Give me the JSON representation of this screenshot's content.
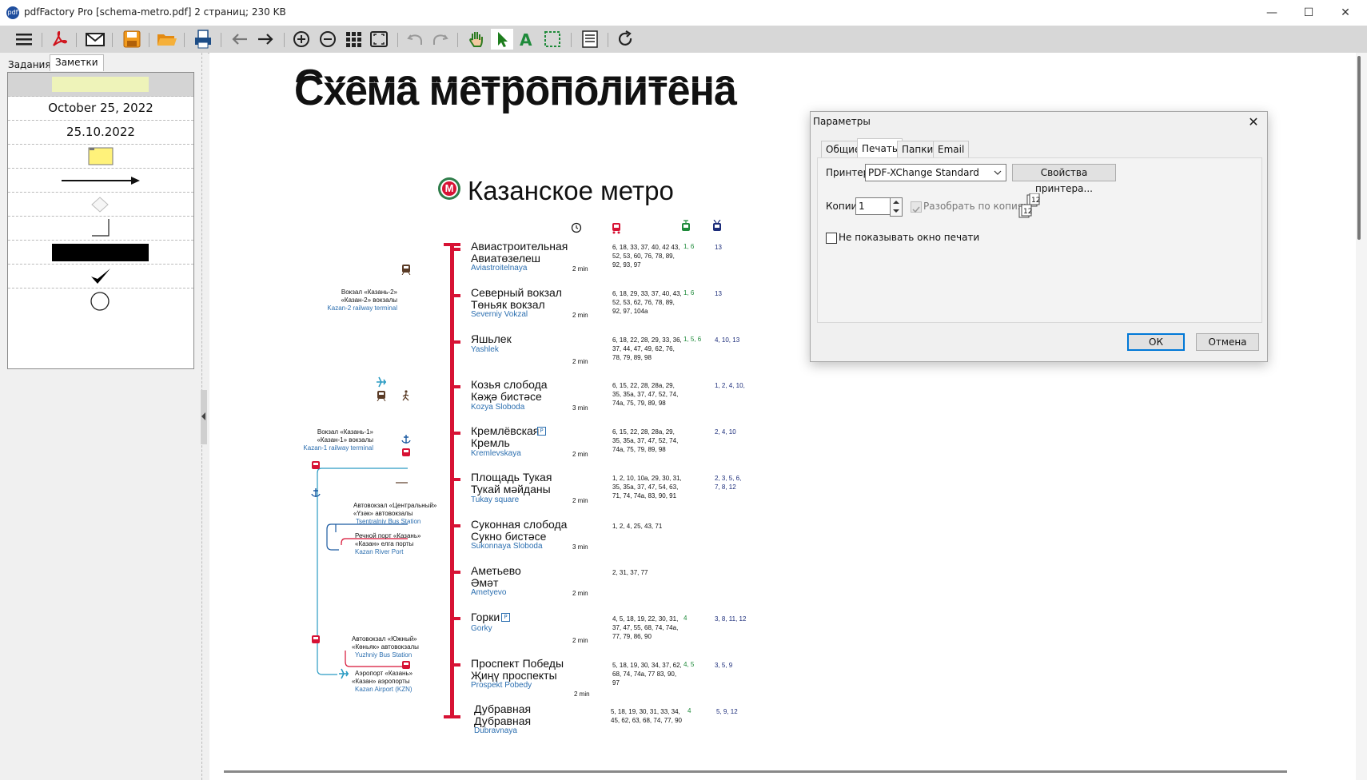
{
  "window": {
    "title": "pdfFactory Pro [schema-metro.pdf] 2 страниц; 230 KB",
    "app_icon_text": "pdf",
    "min_glyph": "—",
    "max_glyph": "☐",
    "close_glyph": "✕"
  },
  "toolbar": {
    "icons": [
      "menu-icon",
      "pdf-icon",
      "email-icon",
      "save-icon",
      "open-folder-icon",
      "print-icon",
      "back-arrow-icon",
      "forward-arrow-icon",
      "zoom-in-icon",
      "zoom-out-icon",
      "thumbnails-icon",
      "fit-page-icon",
      "undo-icon",
      "redo-icon",
      "hand-tool-icon",
      "select-arrow-icon",
      "text-tool-icon",
      "area-select-icon",
      "notes-icon",
      "refresh-icon"
    ]
  },
  "left_panel": {
    "tabs": [
      "Задания",
      "Заметки"
    ],
    "stamps": {
      "date_long": "October 25, 2022",
      "date_short": "25.10.2022"
    }
  },
  "document": {
    "title_ghost": "Схема метрополитена",
    "title": "Схема метрополитена",
    "metro_logo": "М",
    "metro_name": "Казанское метро",
    "stations": [
      {
        "ru": "Авиастроительная",
        "tt": "Авиатөзелеш",
        "lat": "Aviastroitelnaya",
        "time": "2 min",
        "bus": "6, 18, 33, 37, 40, 42 43, 52, 53, 60, 76, 78, 89, 92, 93, 97",
        "tram": "1, 6",
        "trol": "13"
      },
      {
        "ru": "Северный вокзал",
        "tt": "Төньяк вокзал",
        "lat": "Severniy Vokzal",
        "time": "2 min",
        "bus": "6, 18, 29, 33, 37, 40, 43, 52, 53, 62, 76, 78, 89, 92, 97, 104a",
        "tram": "1, 6",
        "trol": "13"
      },
      {
        "ru": "Яшьлек",
        "tt": "",
        "lat": "Yashlek",
        "time": "2 min",
        "bus": "6, 18, 22, 28, 29, 33, 36, 37, 44, 47, 49, 62, 76, 78, 79, 89, 98",
        "tram": "1, 5, 6",
        "trol": "4, 10, 13"
      },
      {
        "ru": "Козья слобода",
        "tt": "Кәҗә бистәсе",
        "lat": "Kozya Sloboda",
        "time": "3 min",
        "bus": "6, 15, 22, 28, 28a, 29, 35, 35a, 37, 47, 52, 74, 74a, 75, 79, 89, 98",
        "tram": "",
        "trol": "1, 2, 4, 10,"
      },
      {
        "ru": "Кремлёвская",
        "tt": "Кремль",
        "lat": "Kremlevskaya",
        "time": "2 min",
        "bus": "6, 15, 22, 28, 28a, 29, 35, 35a, 37, 47, 52, 74, 74a, 75, 79, 89, 98",
        "tram": "",
        "trol": "2, 4, 10"
      },
      {
        "ru": "Площадь Тукая",
        "tt": "Тукай мәйданы",
        "lat": "Tukay square",
        "time": "2 min",
        "bus": "1, 2, 10, 10a, 29, 30, 31, 35, 35a, 37, 47, 54, 63, 71, 74, 74a, 83, 90, 91",
        "tram": "",
        "trol": "2, 3, 5, 6, 7, 8, 12"
      },
      {
        "ru": "Суконная слобода",
        "tt": "Сукно бистәсе",
        "lat": "Sukonnaya Sloboda",
        "time": "3 min",
        "bus": "1, 2, 4, 25, 43, 71",
        "tram": "",
        "trol": ""
      },
      {
        "ru": "Аметьево",
        "tt": "Әмәт",
        "lat": "Ametyevo",
        "time": "2 min",
        "bus": "2, 31, 37, 77",
        "tram": "",
        "trol": ""
      },
      {
        "ru": "Горки",
        "tt": "",
        "lat": "Gorky",
        "time": "2 min",
        "bus": "4, 5, 18, 19, 22, 30, 31, 37, 47, 55, 68, 74, 74a, 77, 79, 86, 90",
        "tram": "4",
        "trol": "3, 8, 11, 12"
      },
      {
        "ru": "Проспект Победы",
        "tt": "Җиңү проспекты",
        "lat": "Prospekt Pobedy",
        "time": "2 min",
        "bus": "5, 18, 19, 30, 34, 37, 62, 68, 74, 74a, 77 83, 90, 97",
        "tram": "4, 5",
        "trol": "3, 5, 9"
      },
      {
        "ru": "Дубравная",
        "tt": "Дубравная",
        "lat": "Dubravnaya",
        "time": "",
        "bus": "5, 18, 19, 30, 31, 33, 34, 45, 62, 63, 68, 74, 77, 90",
        "tram": "4",
        "trol": "5, 9, 12"
      }
    ],
    "connections": {
      "kazan2": {
        "t1": "Вокзал «Казань-2»",
        "t2": "«Казан-2» вокзалы",
        "lat": "Kazan-2 railway terminal"
      },
      "kazan1": {
        "t1": "Вокзал «Казань-1»",
        "t2": "«Казан-1» вокзалы",
        "lat": "Kazan-1 railway terminal"
      },
      "central_bus": {
        "t1": "Автовокзал «Центральный»",
        "t2": "«Үзәк» автовокзалы",
        "lat": "Tsentralniy Bus Station"
      },
      "river_port": {
        "t1": "Речной порт «Казань»",
        "t2": "«Казан» елга порты",
        "lat": "Kazan River Port"
      },
      "south_bus": {
        "t1": "Автовокзал «Южный»",
        "t2": "«Көньяк» автовокзалы",
        "lat": "Yuzhniy Bus Station"
      },
      "airport": {
        "t1": "Аэропорт «Казань»",
        "t2": "«Казан» аэропорты",
        "lat": "Kazan Airport (KZN)"
      }
    }
  },
  "dialog": {
    "title": "Параметры",
    "tabs": [
      "Общие",
      "Печать",
      "Папки",
      "Email"
    ],
    "active_tab": "Печать",
    "printer_label": "Принтер:",
    "printer_value": "PDF-XChange Standard",
    "printer_props_button": "Свойства принтера...",
    "copies_label": "Копии:",
    "copies_value": "1",
    "collate_label": "Разобрать по копиям",
    "no_print_window_label": "Не показывать окно печати",
    "ok": "ОК",
    "cancel": "Отмена"
  }
}
